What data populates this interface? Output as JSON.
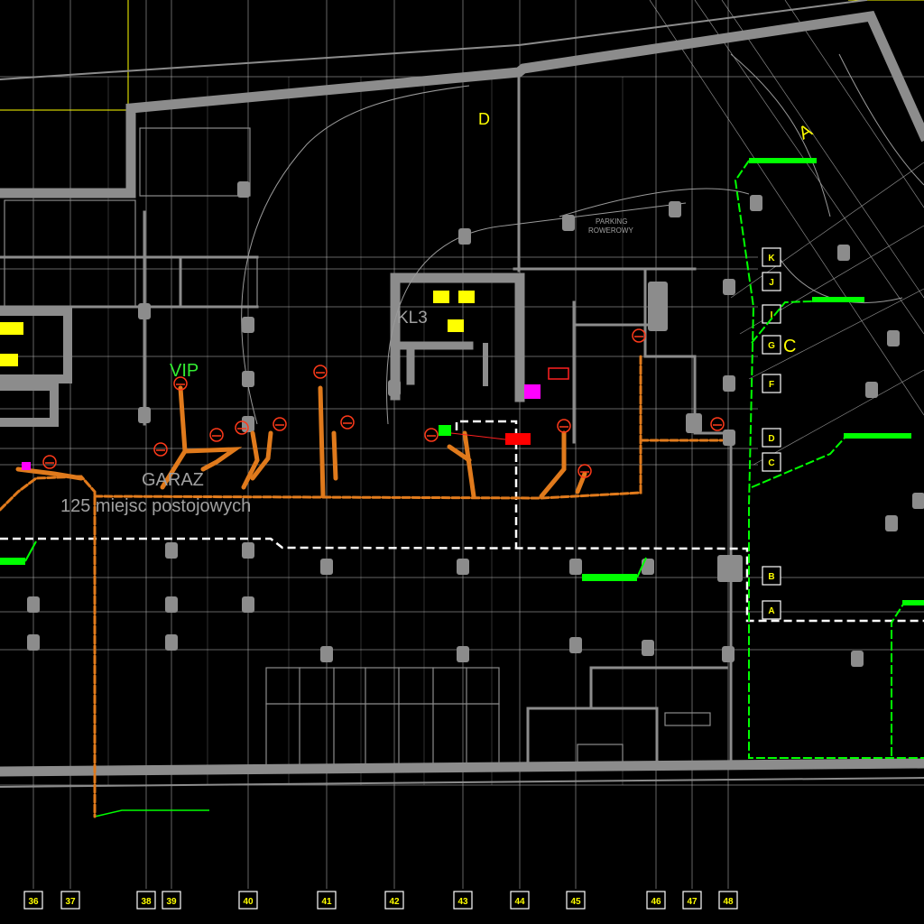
{
  "labels": {
    "vip": "VIP",
    "garaz": "GARAZ",
    "capacity": "125 miejsc postojowych",
    "kl3": "KL3",
    "parking_line1": "PARKING",
    "parking_line2": "ROWEROWY"
  },
  "axes_bottom": [
    "36",
    "37",
    "38",
    "39",
    "40",
    "41",
    "42",
    "43",
    "44",
    "45",
    "46",
    "47",
    "48"
  ],
  "axes_right": [
    "K",
    "J",
    "I",
    "G",
    "F",
    "D",
    "C",
    "B",
    "A"
  ],
  "markers": [
    "A",
    "D",
    "C"
  ],
  "colors": {
    "background": "#000000",
    "wall": "#8c8c8c",
    "grid": "#b4b4b4",
    "drain": "#e07a1c",
    "fire_line": "#00ff00",
    "sprinkler_ring": "#ff3a1a",
    "text_yellow": "#ffff00",
    "text_green": "#33ee33",
    "text_grey": "#a0a0a0",
    "route_white": "#ffffff",
    "alarm_red": "#ff0000",
    "valve_magenta": "#ff00ff"
  }
}
